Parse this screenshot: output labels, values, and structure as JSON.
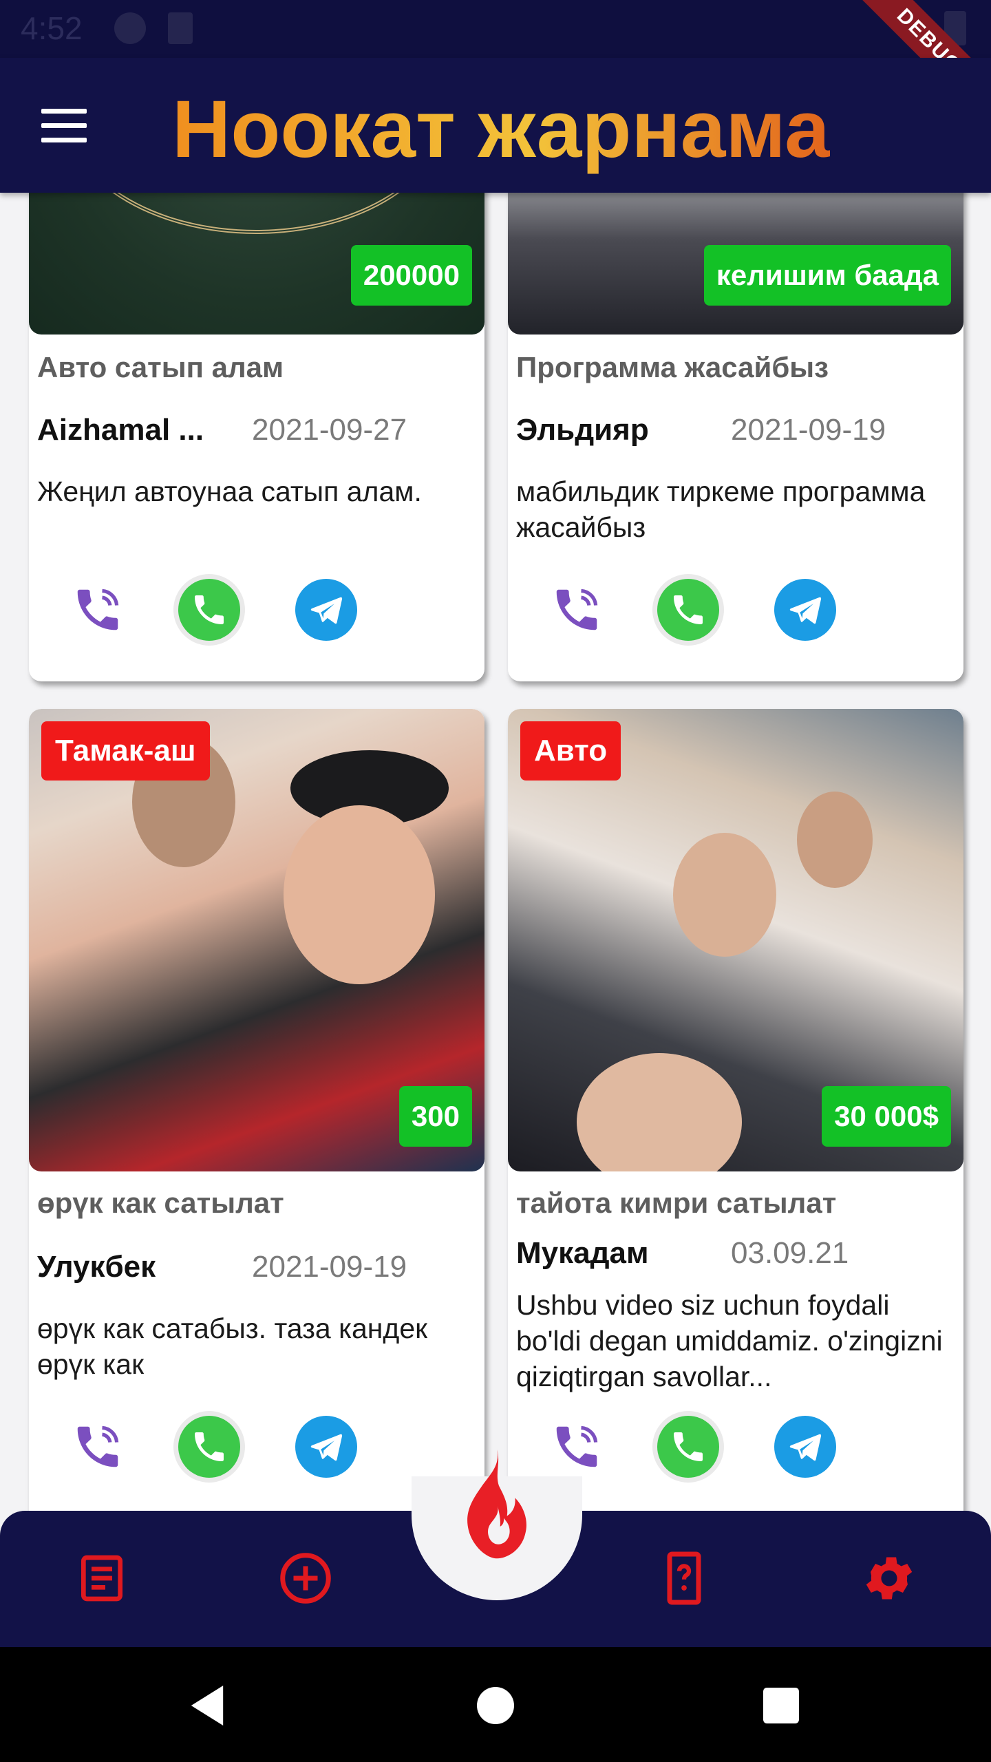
{
  "status_bar": {
    "time": "4:52",
    "debug_label": "DEBUG"
  },
  "app_bar": {
    "title": "Ноокат жарнама",
    "menu_icon": "hamburger-menu-icon"
  },
  "colors": {
    "app_bar_bg": "#121248",
    "price_badge": "#13c126",
    "category_badge": "#f01a1a",
    "nav_icon": "#e0191f",
    "viber": "#7b4fbf",
    "whatsapp": "#3cc84a",
    "telegram": "#1b9ce4"
  },
  "listings": [
    {
      "image": "ornament-photo",
      "price": "200000",
      "category": "",
      "title": "Авто сатып алам",
      "author": "Aizhamal ...",
      "date": "2021-09-27",
      "description": "Жеңил автоунаа сатып алам."
    },
    {
      "image": "mosque-photo",
      "price": "келишим баада",
      "category": "",
      "title": "Программа жасайбыз",
      "author": "Эльдияр",
      "date": "2021-09-19",
      "description": "мабильдик тиркеме программа жасайбыз"
    },
    {
      "image": "sushi-photo",
      "price": "300",
      "category": "Тамак-аш",
      "title": "өрүк как сатылат",
      "author": "Улукбек",
      "date": "2021-09-19",
      "description": "өрүк как сатабыз. таза кандек өрүк как"
    },
    {
      "image": "group-photo",
      "price": "30 000$",
      "category": "Авто",
      "title": "тайота кимри сатылат",
      "author": "Мукадам",
      "date": "03.09.21",
      "description": "Ushbu video siz uchun foydali bo'ldi degan umiddamiz. o'zingizni qiziqtirgan savollar..."
    }
  ],
  "contacts": [
    "viber-icon",
    "whatsapp-icon",
    "telegram-icon"
  ],
  "bottom_nav": {
    "items": [
      "list-icon",
      "add-circle-icon",
      "fire-icon",
      "help-phone-icon",
      "settings-icon"
    ]
  },
  "system_nav": [
    "back-icon",
    "home-icon",
    "recents-icon"
  ]
}
